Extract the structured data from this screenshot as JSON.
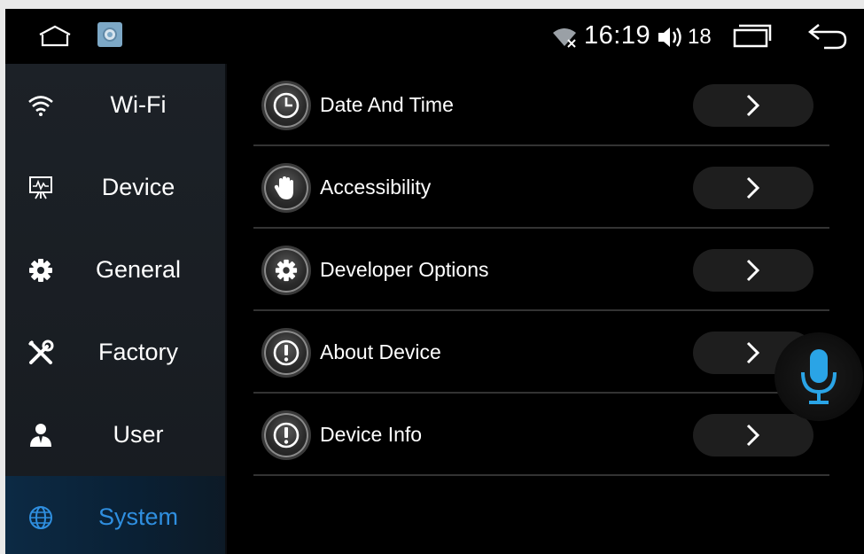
{
  "status_bar": {
    "time": "16:19",
    "volume_level": "18",
    "icons": [
      "home-icon",
      "settings-app-icon",
      "wifi-off-icon",
      "volume-icon",
      "recent-apps-icon",
      "back-icon"
    ]
  },
  "sidebar": {
    "items": [
      {
        "label": "Wi-Fi",
        "icon": "wifi-icon"
      },
      {
        "label": "Device",
        "icon": "monitor-chart-icon"
      },
      {
        "label": "General",
        "icon": "gear-icon"
      },
      {
        "label": "Factory",
        "icon": "tools-icon"
      },
      {
        "label": "User",
        "icon": "user-icon"
      },
      {
        "label": "System",
        "icon": "globe-icon",
        "active": true
      }
    ]
  },
  "main": {
    "rows": [
      {
        "label": "Date And Time",
        "icon": "clock-icon"
      },
      {
        "label": "Accessibility",
        "icon": "hand-icon"
      },
      {
        "label": "Developer Options",
        "icon": "gear-icon"
      },
      {
        "label": "About Device",
        "icon": "info-icon"
      },
      {
        "label": "Device Info",
        "icon": "info-icon"
      }
    ]
  },
  "colors": {
    "accent": "#2f8fe0",
    "mic": "#2aa4e6",
    "background": "#000000",
    "sidebar": "#1b2026"
  }
}
